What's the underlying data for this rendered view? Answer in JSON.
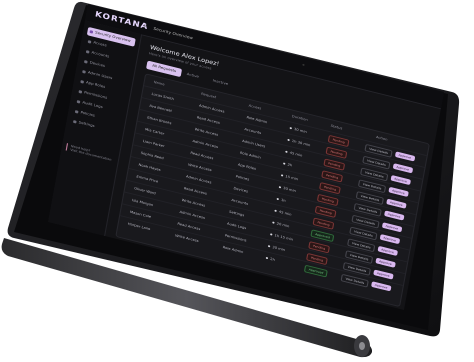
{
  "app": {
    "brand": "KORTANA",
    "breadcrumb_sep": "/",
    "breadcrumb": "Security Overview"
  },
  "sidebar": {
    "items": [
      {
        "label": "Security Overview",
        "active": true
      },
      {
        "label": "Access",
        "active": false
      },
      {
        "label": "Accounts",
        "active": false
      },
      {
        "label": "Devices",
        "active": false
      },
      {
        "label": "Admin Users",
        "active": false
      },
      {
        "label": "App Roles",
        "active": false
      },
      {
        "label": "Permissions",
        "active": false
      },
      {
        "label": "Audit Logs",
        "active": false
      },
      {
        "label": "Policies",
        "active": false
      },
      {
        "label": "Settings",
        "active": false
      }
    ],
    "footer_line1": "Need help?",
    "footer_line2": "Visit the documentation"
  },
  "main": {
    "welcome": "Welcome Alex Lopez!",
    "subtitle": "Here's an overview of your access",
    "tabs": [
      {
        "label": "All Requests",
        "active": true
      },
      {
        "label": "Active",
        "active": false
      },
      {
        "label": "Inactive",
        "active": false
      }
    ]
  },
  "table": {
    "headers": [
      "Name",
      "Request",
      "Access",
      "Duration",
      "Status",
      "Action"
    ],
    "rows": [
      {
        "name": "Lucas Smith",
        "request": "Admin Access",
        "access": "Role Admin",
        "duration": "30 min",
        "status": "Pending",
        "view": "View Details",
        "approve": "Approve"
      },
      {
        "name": "Ava Bennett",
        "request": "Read Access",
        "access": "Accounts",
        "duration": "1h 30 min",
        "status": "Pending",
        "view": "View Details",
        "approve": "Approve"
      },
      {
        "name": "Ethan Brooks",
        "request": "Write Access",
        "access": "Admin Users",
        "duration": "45 min",
        "status": "Pending",
        "view": "View Details",
        "approve": "Approve"
      },
      {
        "name": "Mia Carter",
        "request": "Admin Access",
        "access": "Role Admin",
        "duration": "2h",
        "status": "Pending",
        "view": "View Details",
        "approve": "Approve"
      },
      {
        "name": "Liam Parker",
        "request": "Read Access",
        "access": "App Roles",
        "duration": "15 min",
        "status": "Pending",
        "view": "View Details",
        "approve": "Approve"
      },
      {
        "name": "Sophia Reed",
        "request": "Write Access",
        "access": "Policies",
        "duration": "30 min",
        "status": "Pending",
        "view": "View Details",
        "approve": "Approve"
      },
      {
        "name": "Noah Hayes",
        "request": "Admin Access",
        "access": "Devices",
        "duration": "1h",
        "status": "Pending",
        "view": "View Details",
        "approve": "Approve"
      },
      {
        "name": "Emma Price",
        "request": "Read Access",
        "access": "Accounts",
        "duration": "45 min",
        "status": "Pending",
        "view": "View Details",
        "approve": "Approve"
      },
      {
        "name": "Oliver Ward",
        "request": "Write Access",
        "access": "Settings",
        "duration": "20 min",
        "status": "Approved",
        "view": "View Details",
        "approve": "Approve"
      },
      {
        "name": "Isla Morgan",
        "request": "Admin Access",
        "access": "Audit Logs",
        "duration": "1h 15 min",
        "status": "Pending",
        "view": "View Details",
        "approve": "Approve"
      },
      {
        "name": "Mason Cole",
        "request": "Read Access",
        "access": "Permissions",
        "duration": "30 min",
        "status": "Pending",
        "view": "View Details",
        "approve": "Approve"
      },
      {
        "name": "Harper Lane",
        "request": "Write Access",
        "access": "Role Admin",
        "duration": "2h",
        "status": "Approved",
        "view": "View Details",
        "approve": "Approve"
      }
    ]
  },
  "colors": {
    "accent": "#d9c2f0",
    "background": "#131316",
    "device": "#1b1b1e"
  }
}
